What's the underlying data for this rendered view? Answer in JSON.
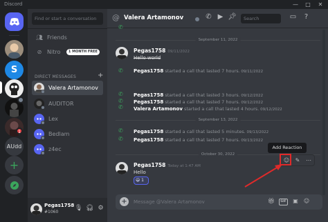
{
  "window": {
    "title": "Discord",
    "controls": [
      "—",
      "□",
      "✕"
    ]
  },
  "servers": [
    {
      "label": "",
      "badge": ""
    },
    {
      "label": "",
      "badge": ""
    },
    {
      "label": "",
      "badge": ""
    },
    {
      "label": "",
      "badge": ""
    },
    {
      "label": "",
      "badge": "1"
    },
    {
      "label": "AUdd",
      "badge": ""
    }
  ],
  "sidebar": {
    "search_placeholder": "Find or start a conversation",
    "friends": "Friends",
    "nitro": "Nitro",
    "nitro_badge": "1 MONTH FREE",
    "dm_heading": "DIRECT MESSAGES",
    "dm_add": "+",
    "dms": [
      "Valera Artamonov",
      "AUDITOR",
      "Lex",
      "Bedlam",
      "z4ec"
    ]
  },
  "user_panel": {
    "name": "Pegas1758",
    "tag": "#1060"
  },
  "header": {
    "at": "@",
    "name": "Valera Artamonov",
    "search_placeholder": "Search"
  },
  "messages": {
    "date1": "September 11, 2022",
    "msg1_author": "Pegas1758",
    "msg1_time": "09/11/2022",
    "msg1_text": "Hello world",
    "call1": {
      "who": "Pegas1758",
      "text": " started a call that lasted 7 hours.",
      "date": " 09/11/2022"
    },
    "call2": {
      "who": "Pegas1758",
      "text": " started a call that lasted 3 hours.",
      "date": " 09/12/2022"
    },
    "call3": {
      "who": "Pegas1758",
      "text": " started a call that lasted 7 hours.",
      "date": " 09/12/2022"
    },
    "call4": {
      "who": "Valera Artamonov",
      "text": " started a call that lasted 4 hours.",
      "date": " 09/12/2022"
    },
    "date2": "September 13, 2022",
    "call5": {
      "who": "Pegas1758",
      "text": " started a call that lasted 5 minutes.",
      "date": " 09/13/2022"
    },
    "call6": {
      "who": "Pegas1758",
      "text": " started a call that lasted 7 hours.",
      "date": " 09/13/2022"
    },
    "date3": "October 30, 2022",
    "msg2_author": "Pegas1758",
    "msg2_time": "Today at 1:47 AM",
    "msg2_text": "Hello",
    "reaction": "😃 1",
    "tooltip": "Add Reaction"
  },
  "composer": {
    "placeholder": "Message @Valera Artamonov",
    "gif": "GIF"
  },
  "colors": {
    "accent": "#5865f2",
    "call_green": "#3ba55c",
    "annotation_red": "#e02a2a"
  }
}
